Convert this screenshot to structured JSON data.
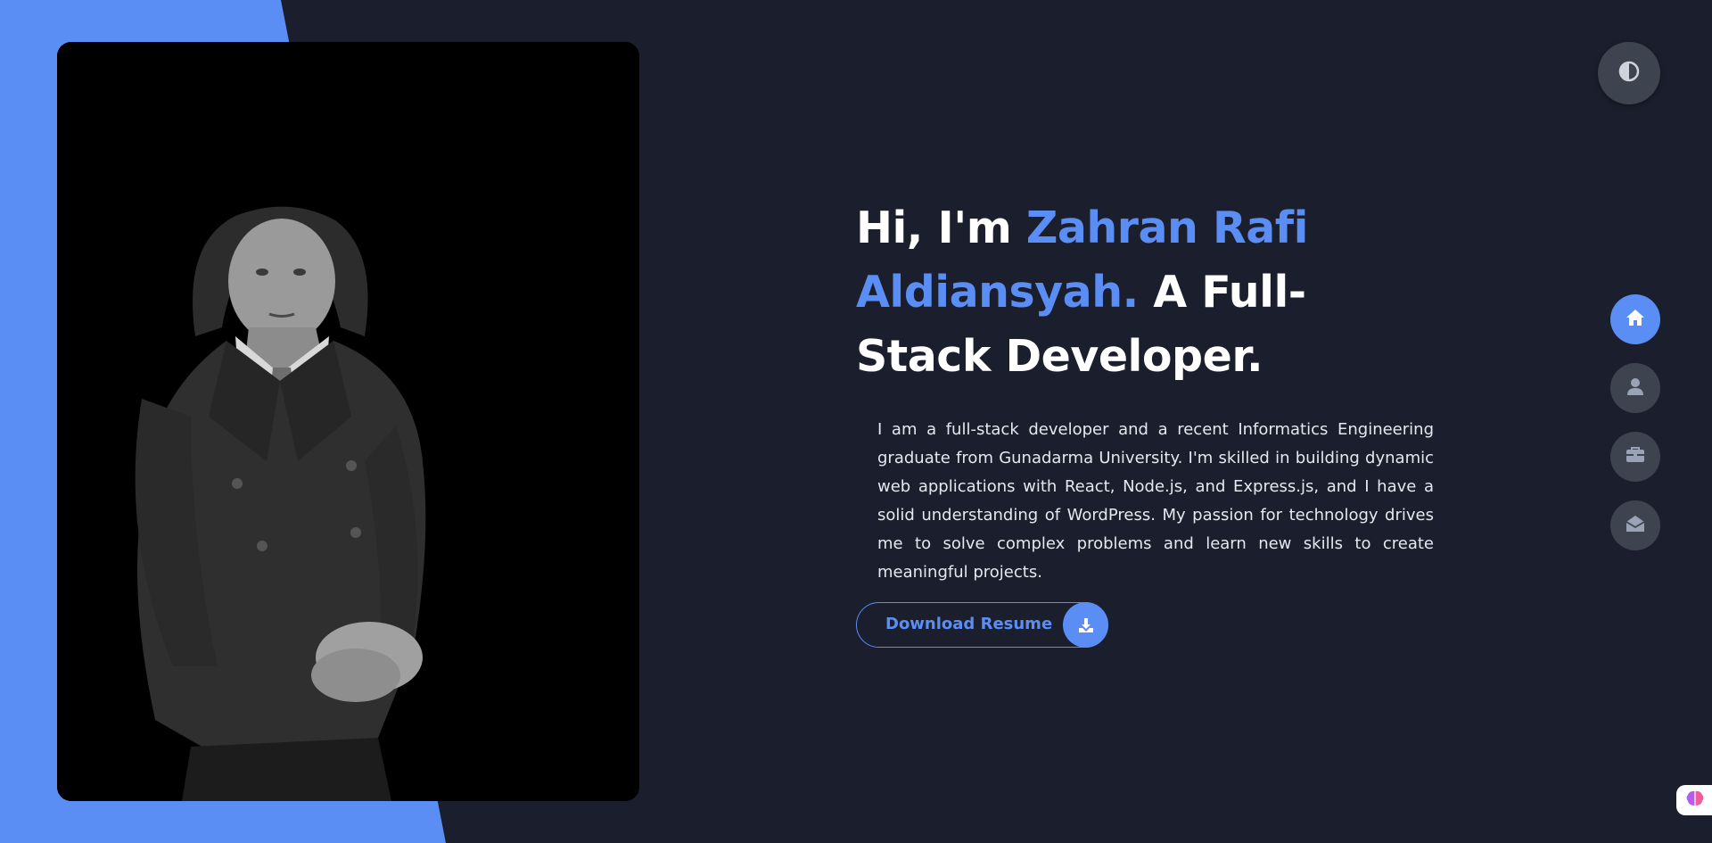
{
  "hero": {
    "greeting": "Hi, I'm ",
    "name": "Zahran Rafi Aldiansyah.",
    "role": " A Full-Stack Developer.",
    "about": "I am a full-stack developer and a recent Informatics Engineering graduate from Gunadarma University. I'm skilled in building dynamic web applications with React, Node.js, and Express.js, and I have a solid understanding of WordPress. My passion for technology drives me to solve complex problems and learn new skills to create meaningful projects."
  },
  "resume_button": {
    "label": "Download Resume",
    "icon": "download-icon"
  },
  "theme_toggle": {
    "icon": "contrast-icon"
  },
  "nav": [
    {
      "icon": "home-icon",
      "active": true
    },
    {
      "icon": "user-icon",
      "active": false
    },
    {
      "icon": "briefcase-icon",
      "active": false
    },
    {
      "icon": "envelope-open-icon",
      "active": false
    }
  ],
  "colors": {
    "background": "#1b1e2c",
    "accent": "#5b8ef4",
    "button_gray": "#3e4350",
    "text": "#ffffff"
  }
}
